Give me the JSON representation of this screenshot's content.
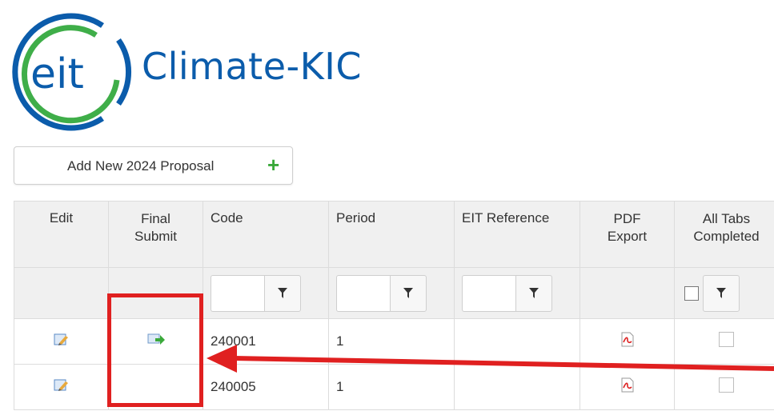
{
  "brand": {
    "logo_text": "eit",
    "name": "Climate-KIC"
  },
  "toolbar": {
    "add_label": "Add New 2024 Proposal",
    "add_icon": "plus-icon"
  },
  "grid": {
    "columns": [
      "Edit",
      "Final Submit",
      "Code",
      "Period",
      "EIT Reference",
      "PDF Export",
      "All Tabs Completed"
    ],
    "rows": [
      {
        "code": "240001",
        "period": "1",
        "eit_reference": "",
        "has_final_submit": true
      },
      {
        "code": "240005",
        "period": "1",
        "eit_reference": "",
        "has_final_submit": false
      }
    ]
  },
  "colors": {
    "brand_blue": "#0b5cab",
    "logo_green": "#3fae49",
    "highlight": "#e02020",
    "add_icon_green": "#3aa93a"
  }
}
